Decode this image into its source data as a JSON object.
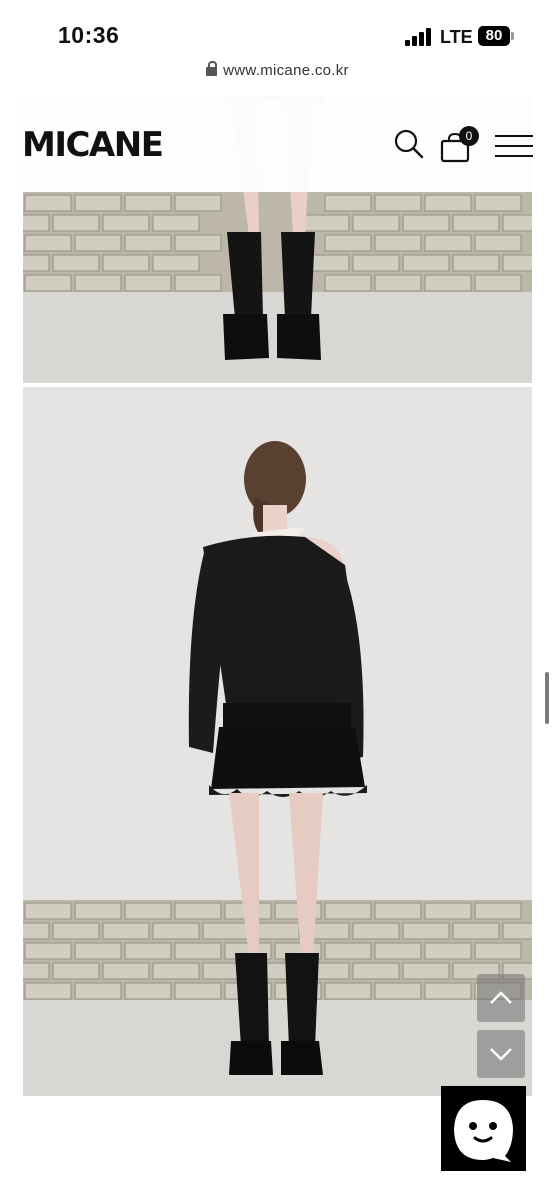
{
  "status_bar": {
    "time": "10:36",
    "network": "LTE",
    "battery": "80"
  },
  "browser": {
    "url": "www.micane.co.kr"
  },
  "site": {
    "logo": "MICANE",
    "cart_count": "0"
  },
  "icons": {
    "search": "search-icon",
    "cart": "shopping-bag-icon",
    "menu": "hamburger-menu-icon",
    "scroll_up": "chevron-up-icon",
    "scroll_down": "chevron-down-icon",
    "chat": "chat-bot-icon"
  },
  "colors": {
    "header_bg": "#ffffff",
    "float_button": "#8a8a8a",
    "chat_bg": "#000000"
  }
}
